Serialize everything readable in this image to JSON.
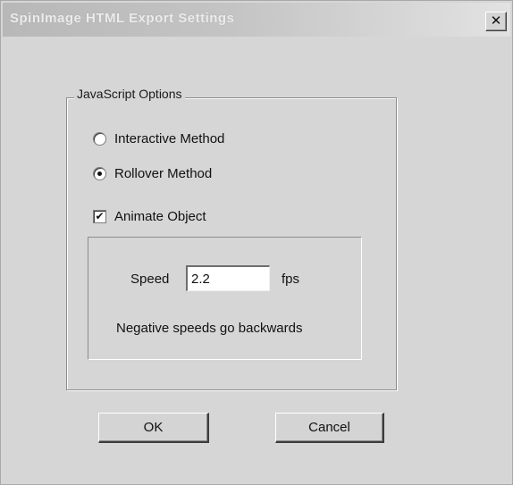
{
  "window": {
    "title": "SpinImage HTML Export Settings",
    "close_label": "✕"
  },
  "javascript_options": {
    "legend": "JavaScript Options",
    "methods": [
      {
        "label": "Interactive Method",
        "selected": false
      },
      {
        "label": "Rollover Method",
        "selected": true
      }
    ],
    "animate": {
      "label": "Animate Object",
      "checked": true,
      "check_mark": "✔"
    },
    "speed": {
      "label": "Speed",
      "value": "2.2",
      "unit": "fps",
      "hint": "Negative speeds go backwards"
    }
  },
  "buttons": {
    "ok_label": "OK",
    "cancel_label": "Cancel"
  }
}
